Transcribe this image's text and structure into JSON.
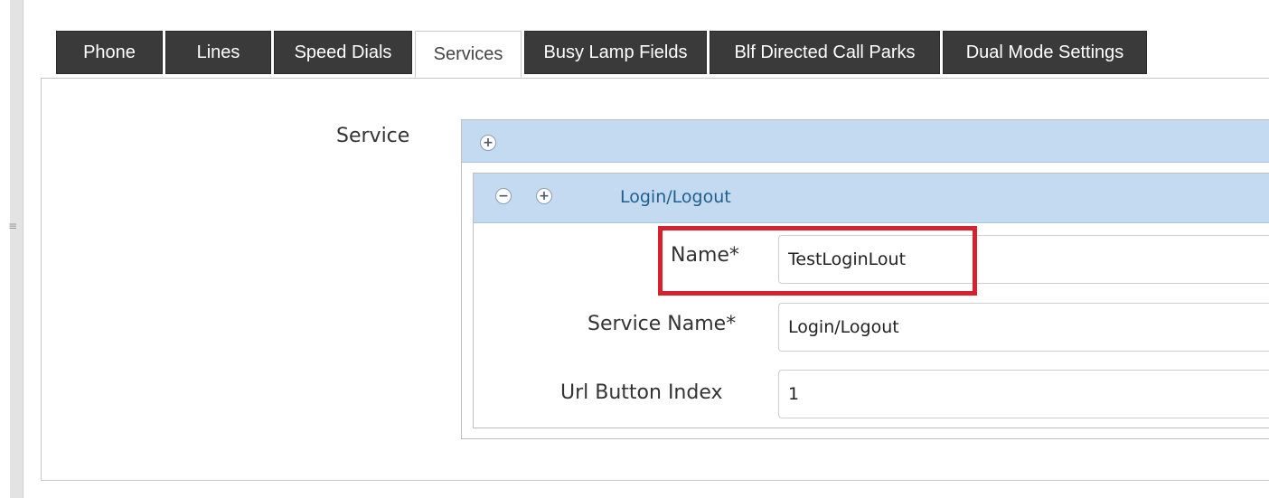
{
  "tabs": [
    {
      "label": "Phone"
    },
    {
      "label": "Lines"
    },
    {
      "label": "Speed Dials"
    },
    {
      "label": "Services"
    },
    {
      "label": "Busy Lamp Fields"
    },
    {
      "label": "Blf Directed Call Parks"
    },
    {
      "label": "Dual Mode Settings"
    }
  ],
  "active_tab": "Services",
  "service_section": {
    "label": "Service",
    "add_icon": "plus-icon",
    "item": {
      "title": "Login/Logout",
      "remove_icon": "minus-icon",
      "add_icon": "plus-icon",
      "fields": {
        "name": {
          "label": "Name*",
          "value": "TestLoginLout"
        },
        "service_name": {
          "label": "Service Name*",
          "value": "Login/Logout"
        },
        "url_button_index": {
          "label": "Url Button Index",
          "value": "1"
        }
      }
    }
  },
  "colors": {
    "tab_dark": "#3a3a3a",
    "header_blue": "#c4daf0",
    "highlight_red": "#d8212f",
    "title_blue": "#1f5f8f"
  },
  "rail": {
    "grip_glyph": "≡"
  }
}
